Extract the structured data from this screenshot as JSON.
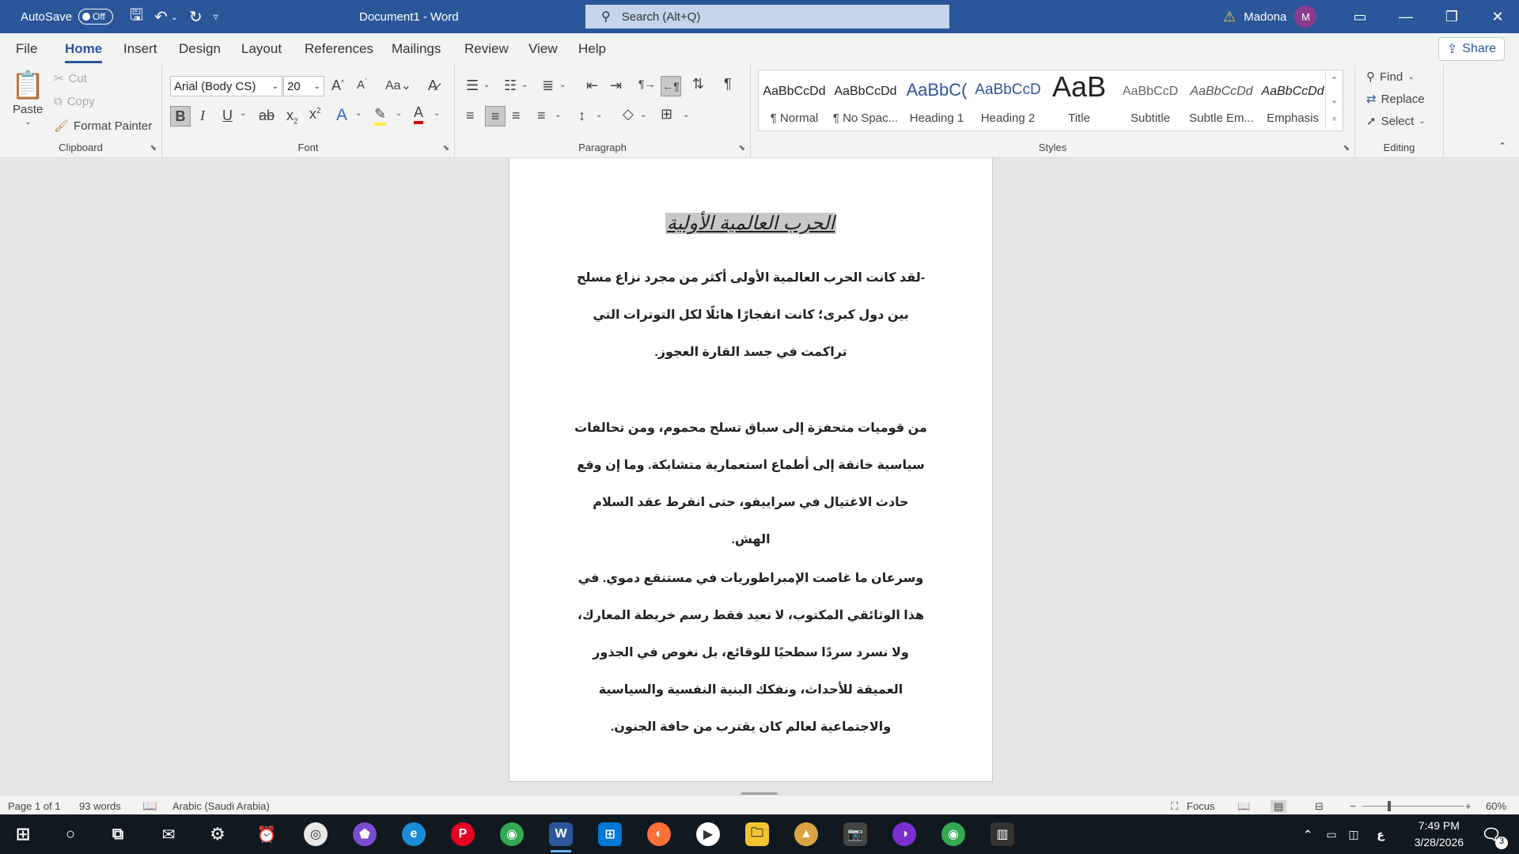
{
  "titlebar": {
    "autosave_label": "AutoSave",
    "autosave_state": "Off",
    "doc_title": "Document1  -  Word",
    "search_placeholder": "Search (Alt+Q)",
    "user_name": "Madona",
    "user_initial": "M"
  },
  "tabs": [
    "File",
    "Home",
    "Insert",
    "Design",
    "Layout",
    "References",
    "Mailings",
    "Review",
    "View",
    "Help"
  ],
  "share_label": "Share",
  "clipboard": {
    "paste": "Paste",
    "cut": "Cut",
    "copy": "Copy",
    "format_painter": "Format Painter",
    "label": "Clipboard"
  },
  "font": {
    "font_name": "Arial (Body CS)",
    "font_size": "20",
    "label": "Font"
  },
  "paragraph": {
    "label": "Paragraph"
  },
  "styles": {
    "label": "Styles",
    "items": [
      {
        "preview": "AaBbCcDd",
        "name": "¶ Normal"
      },
      {
        "preview": "AaBbCcDd",
        "name": "¶ No Spac..."
      },
      {
        "preview": "AaBbC(",
        "name": "Heading 1"
      },
      {
        "preview": "AaBbCcD",
        "name": "Heading 2"
      },
      {
        "preview": "AaB",
        "name": "Title"
      },
      {
        "preview": "AaBbCcD",
        "name": "Subtitle"
      },
      {
        "preview": "AaBbCcDd",
        "name": "Subtle Em..."
      },
      {
        "preview": "AaBbCcDd",
        "name": "Emphasis"
      }
    ]
  },
  "editing": {
    "find": "Find",
    "replace": "Replace",
    "select": "Select",
    "label": "Editing"
  },
  "document": {
    "title": "الحرب العالمية الأولية",
    "paragraphs": [
      "-لقد كانت الحرب العالمية الأولى أكثر من مجرد نزاع مسلح بين دول كبرى؛ كانت انفجارًا هائلًا لكل التوترات التي تراكمت في جسد القارة العجوز.",
      "من قوميات متحفزة إلى سباق تسلح محموم، ومن تحالفات سياسية خانقة إلى أطماع استعمارية متشابكة. وما إن وقع حادث الاغتيال في سراييفو، حتى انفرط عقد السلام الهش.",
      "وسرعان ما غاصت الإمبراطوريات في مستنقع دموي. في هذا الوثائقي المكتوب، لا نعيد فقط رسم خريطة المعارك، ولا نسرد سردًا سطحيًا للوقائع، بل نغوص في الجذور العميقة للأحداث، ونفكك البنية النفسية والسياسية والاجتماعية لعالم كان يقترب من حافة الجنون."
    ]
  },
  "status": {
    "page": "Page 1 of 1",
    "words": "93 words",
    "language": "Arabic (Saudi Arabia)",
    "focus": "Focus",
    "zoom": "60%"
  },
  "taskbar": {
    "time": "7:49 PM",
    "date": "3/28/2026",
    "lang": "ع",
    "notif_count": "3"
  }
}
